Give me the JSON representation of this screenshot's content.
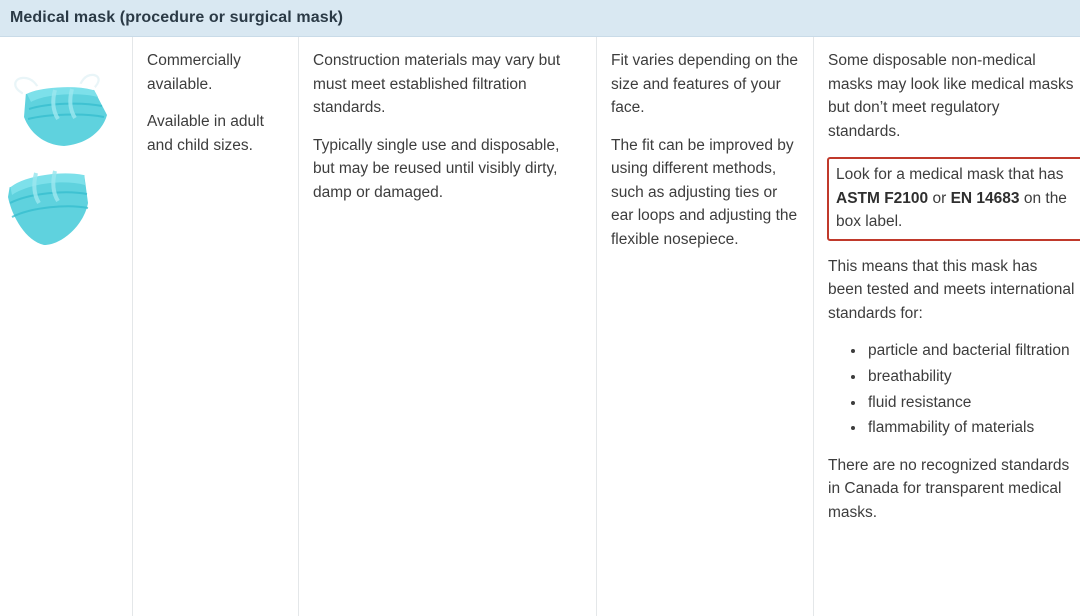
{
  "header": {
    "title": "Medical mask (procedure or surgical mask)",
    "background_color": "#d9e8f2",
    "text_color": "#2b3a46"
  },
  "columns": {
    "image": {
      "alt_name": "medical-mask-illustration",
      "mask_color": "#5fd2de",
      "mask_shadow_color": "#3ab9cb",
      "strap_color": "#ffffff"
    },
    "availability": {
      "paragraphs": [
        "Commercially available.",
        "Available in adult and child sizes."
      ]
    },
    "construction": {
      "paragraphs": [
        "Construction materials may vary but must meet established filtration standards.",
        "Typically single use and disposable, but may be reused until visibly dirty, damp or damaged."
      ]
    },
    "fit": {
      "paragraphs": [
        "Fit varies depending on the size and features of your face.",
        "The fit can be improved by using different methods, such as adjusting ties or ear loops and adjusting the flexible nosepiece."
      ]
    },
    "other": {
      "intro": "Some disposable non-medical masks may look like medical masks but don’t meet regulatory standards.",
      "highlight": {
        "text_before": "Look for a medical mask that has ",
        "standard_1": "ASTM F2100",
        "text_middle": " or ",
        "standard_2": "EN 14683",
        "text_after": " on the box label.",
        "border_color": "#c0392b"
      },
      "means_text": "This means that this mask has been tested and meets international standards for:",
      "standards_list": [
        "particle and bacterial filtration",
        "breathability",
        "fluid resistance",
        "flammability of materials"
      ],
      "closing": "There are no recognized standards in Canada for transparent medical masks."
    }
  }
}
